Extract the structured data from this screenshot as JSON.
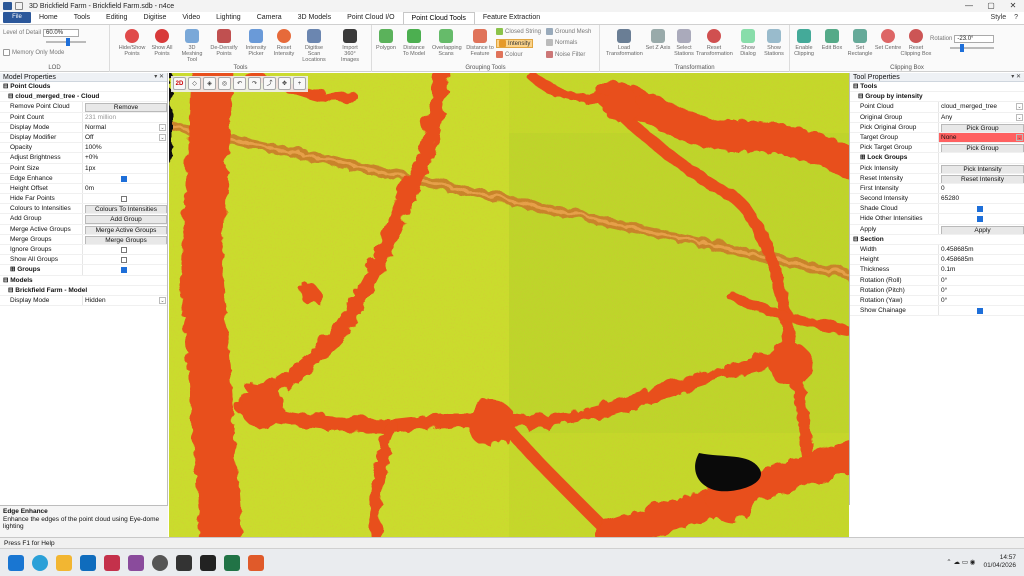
{
  "window": {
    "title": "3D Brickfield Farm - Brickfield Farm.sdb - n4ce",
    "controls": [
      "—",
      "▢",
      "✕"
    ]
  },
  "menu": {
    "file": "File",
    "tabs": [
      "Home",
      "Tools",
      "Editing",
      "Digitise",
      "Video",
      "Lighting",
      "Camera",
      "3D Models",
      "Point Cloud I/O",
      "Point Cloud Tools",
      "Feature Extraction"
    ],
    "active_tab": "Point Cloud Tools",
    "style_label": "Style"
  },
  "ribbon": {
    "lod": {
      "label": "Level of Detail",
      "value": "60.0%",
      "memory_only": "Memory Only Mode",
      "group": "LOD"
    },
    "tools": {
      "group": "Tools",
      "buttons": [
        "Hide/Show Points",
        "Show All Points",
        "3D Meshing Tool",
        "De-Densify Points",
        "Intensity Picker",
        "Reset Intensity",
        "Digitise Scan Locations",
        "Import 360° Images"
      ]
    },
    "grouping": {
      "group": "Grouping Tools",
      "buttons": [
        "Polygon",
        "Distance To Model",
        "Overlapping Scans",
        "Distance to Feature"
      ],
      "small": [
        "Closed String",
        "Ground Mesh",
        "Intensity",
        "Normals",
        "Colour",
        "Noise Filter"
      ]
    },
    "transformation": {
      "group": "Transformation",
      "buttons": [
        "Load Transformation",
        "Set Z Axis",
        "Select Stations",
        "Reset Transformation",
        "Show Dialog",
        "Show Stations"
      ]
    },
    "clipping": {
      "group": "Clipping Box",
      "buttons": [
        "Enable Clipping",
        "Edit Box",
        "Set Rectangle",
        "Set Centre",
        "Reset Clipping Box"
      ],
      "rotation_label": "Rotation",
      "rotation_value": "-23.0°"
    }
  },
  "left_panel": {
    "title": "Model Properties",
    "rows": [
      {
        "k": "Point Clouds",
        "type": "sec"
      },
      {
        "k": "cloud_merged_tree - Cloud",
        "type": "sub"
      },
      {
        "k": "Remove Point Cloud",
        "v": "Remove",
        "type": "btn"
      },
      {
        "k": "Point Count",
        "v": "231 million",
        "type": "grey"
      },
      {
        "k": "Display Mode",
        "v": "Normal",
        "type": "dd"
      },
      {
        "k": "Display Modifier",
        "v": "Off",
        "type": "dd"
      },
      {
        "k": "Opacity",
        "v": "100%",
        "type": "text"
      },
      {
        "k": "Adjust Brightness",
        "v": "+0%",
        "type": "text"
      },
      {
        "k": "Point Size",
        "v": "1px",
        "type": "text"
      },
      {
        "k": "Edge Enhance",
        "v": "",
        "type": "chk_on"
      },
      {
        "k": "Height Offset",
        "v": "0m",
        "type": "text"
      },
      {
        "k": "Hide Far Points",
        "v": "",
        "type": "chk"
      },
      {
        "k": "Colours to Intensities",
        "v": "Colours To Intensities",
        "type": "btn"
      },
      {
        "k": "Add Group",
        "v": "Add Group",
        "type": "btn"
      },
      {
        "k": "Merge Active Groups",
        "v": "Merge Active Groups",
        "type": "btn"
      },
      {
        "k": "Merge Groups",
        "v": "Merge Groups",
        "type": "btn"
      },
      {
        "k": "Ignore Groups",
        "v": "",
        "type": "chk"
      },
      {
        "k": "Show All Groups",
        "v": "",
        "type": "chk"
      },
      {
        "k": "Groups",
        "v": "",
        "type": "sub_chk"
      },
      {
        "k": "Models",
        "type": "sec"
      },
      {
        "k": "Brickfield Farm - Model",
        "type": "sub"
      },
      {
        "k": "Display Mode",
        "v": "Hidden",
        "type": "dd"
      }
    ]
  },
  "description": {
    "title": "Edge Enhance",
    "text": "Enhance the edges of the point cloud using Eye-dome lighting"
  },
  "right_panel": {
    "title": "Tool Properties",
    "rows": [
      {
        "k": "Tools",
        "type": "sec"
      },
      {
        "k": "Group by intensity",
        "type": "sub"
      },
      {
        "k": "Point Cloud",
        "v": "cloud_merged_tree",
        "type": "dd"
      },
      {
        "k": "Original Group",
        "v": "Any",
        "type": "dd"
      },
      {
        "k": "Pick Original Group",
        "v": "Pick Group",
        "type": "btn"
      },
      {
        "k": "Target Group",
        "v": "None",
        "type": "dd_red"
      },
      {
        "k": "Pick Target Group",
        "v": "Pick Group",
        "type": "btn"
      },
      {
        "k": "Lock Groups",
        "v": "",
        "type": "sub"
      },
      {
        "k": "Pick Intensity",
        "v": "Pick Intensity",
        "type": "btn"
      },
      {
        "k": "Reset Intensity",
        "v": "Reset Intensity",
        "type": "btn"
      },
      {
        "k": "First Intensity",
        "v": "0",
        "type": "text"
      },
      {
        "k": "Second Intensity",
        "v": "65280",
        "type": "text"
      },
      {
        "k": "Shade Cloud",
        "v": "",
        "type": "chk_on"
      },
      {
        "k": "Hide Other Intensities",
        "v": "",
        "type": "chk_on"
      },
      {
        "k": "Apply",
        "v": "Apply",
        "type": "btn"
      },
      {
        "k": "Section",
        "type": "sec"
      },
      {
        "k": "Width",
        "v": "0.458685m",
        "type": "text"
      },
      {
        "k": "Height",
        "v": "0.458685m",
        "type": "text"
      },
      {
        "k": "Thickness",
        "v": "0.1m",
        "type": "text"
      },
      {
        "k": "Rotation (Roll)",
        "v": "0°",
        "type": "text"
      },
      {
        "k": "Rotation (Pitch)",
        "v": "0°",
        "type": "text"
      },
      {
        "k": "Rotation (Yaw)",
        "v": "0°",
        "type": "text"
      },
      {
        "k": "Show Chainage",
        "v": "",
        "type": "chk_on"
      }
    ]
  },
  "viewport_toolbar": {
    "mode": "2D"
  },
  "status": {
    "text": "Press F1 for Help"
  },
  "taskbar": {
    "time": "14:57",
    "date": "01/04/2026"
  },
  "colors": {
    "accent": "#1e6fd9",
    "field": "#c8dc2a",
    "hedge": "#e8501a",
    "target_red": "#ff6060"
  }
}
